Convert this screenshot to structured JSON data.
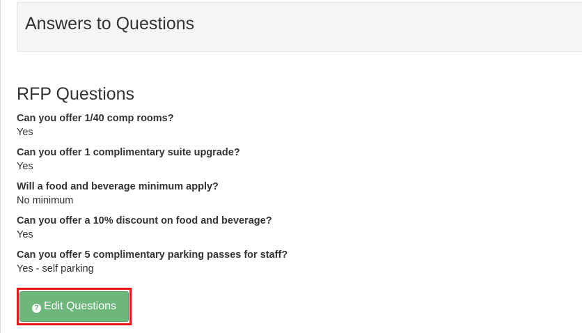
{
  "header": {
    "title": "Answers to Questions"
  },
  "section": {
    "title": "RFP Questions"
  },
  "questions": [
    {
      "question": "Can you offer 1/40 comp rooms?",
      "answer": "Yes"
    },
    {
      "question": "Can you offer 1 complimentary suite upgrade?",
      "answer": "Yes"
    },
    {
      "question": "Will a food and beverage minimum apply?",
      "answer": "No minimum"
    },
    {
      "question": "Can you offer a 10% discount on food and beverage?",
      "answer": "Yes"
    },
    {
      "question": "Can you offer 5 complimentary parking passes for staff?",
      "answer": "Yes - self parking"
    }
  ],
  "actions": {
    "edit_label": "Edit Questions",
    "edit_icon": "question-circle-icon",
    "button_color": "#6db77a",
    "highlight_color": "#e8171b"
  }
}
